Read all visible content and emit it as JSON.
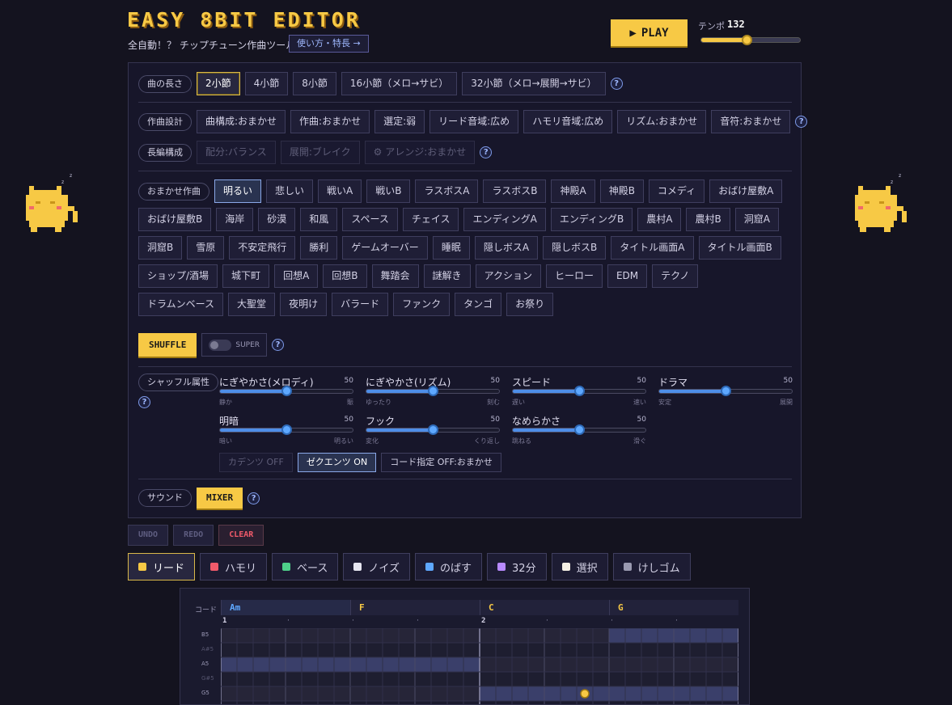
{
  "header": {
    "title": "EASY 8BIT EDITOR",
    "subtitle": "全自動！？ チップチューン作曲ツール",
    "howto_label": "使い方・特長 →",
    "play_label": "PLAY",
    "tempo_label": "テンポ",
    "tempo_value": "132",
    "tempo_fraction": 0.46
  },
  "length": {
    "label": "曲の長さ",
    "options": [
      "2小節",
      "4小節",
      "8小節",
      "16小節（メロ→サビ）",
      "32小節（メロ→展開→サビ）"
    ],
    "selected": "2小節"
  },
  "design": {
    "label": "作曲設計",
    "options": [
      "曲構成:おまかせ",
      "作曲:おまかせ",
      "選定:弱",
      "リード音域:広め",
      "ハモリ音域:広め",
      "リズム:おまかせ",
      "音符:おまかせ"
    ]
  },
  "long_form": {
    "label": "長編構成",
    "options": [
      "配分:バランス",
      "展開:ブレイク",
      "アレンジ:おまかせ"
    ],
    "gear_icon": "⚙"
  },
  "auto": {
    "label": "おまかせ作曲",
    "selected": "明るい",
    "styles": [
      "明るい",
      "悲しい",
      "戦いA",
      "戦いB",
      "ラスボスA",
      "ラスボスB",
      "神殿A",
      "神殿B",
      "コメディ",
      "おばけ屋敷A",
      "おばけ屋敷B",
      "海岸",
      "砂漠",
      "和風",
      "スペース",
      "チェイス",
      "エンディングA",
      "エンディングB",
      "農村A",
      "農村B",
      "洞窟A",
      "洞窟B",
      "雪原",
      "不安定飛行",
      "勝利",
      "ゲームオーバー",
      "睡眠",
      "隠しボスA",
      "隠しボスB",
      "タイトル画面A",
      "タイトル画面B",
      "ショップ/酒場",
      "城下町",
      "回想A",
      "回想B",
      "舞踏会",
      "謎解き",
      "アクション",
      "ヒーロー",
      "EDM",
      "テクノ",
      "ドラムンベース",
      "大聖堂",
      "夜明け",
      "バラード",
      "ファンク",
      "タンゴ",
      "お祭り"
    ]
  },
  "shuffle": {
    "label": "SHUFFLE",
    "super_label": "SUPER"
  },
  "attributes": {
    "label": "シャッフル属性",
    "sliders": [
      {
        "name": "にぎやかさ(メロディ)",
        "value": "50",
        "lo": "静か",
        "hi": "賑"
      },
      {
        "name": "にぎやかさ(リズム)",
        "value": "50",
        "lo": "ゆったり",
        "hi": "刻む"
      },
      {
        "name": "スピード",
        "value": "50",
        "lo": "遅い",
        "hi": "速い"
      },
      {
        "name": "ドラマ",
        "value": "50",
        "lo": "安定",
        "hi": "展開"
      },
      {
        "name": "明暗",
        "value": "50",
        "lo": "暗い",
        "hi": "明るい"
      },
      {
        "name": "フック",
        "value": "50",
        "lo": "変化",
        "hi": "くり返し"
      },
      {
        "name": "なめらかさ",
        "value": "50",
        "lo": "跳ねる",
        "hi": "滑ぐ"
      }
    ],
    "toggles": [
      "カデンツ OFF",
      "ゼクエンツ ON",
      "コード指定 OFF:おまかせ"
    ]
  },
  "sound": {
    "label": "サウンド",
    "mixer_label": "MIXER"
  },
  "history": {
    "undo": "UNDO",
    "redo": "REDO",
    "clear": "CLEAR"
  },
  "tools": [
    {
      "label": "リード",
      "color": "#f7c945"
    },
    {
      "label": "ハモリ",
      "color": "#f05a6a"
    },
    {
      "label": "ベース",
      "color": "#4ed08a"
    },
    {
      "label": "ノイズ",
      "color": "#e6e6f0"
    },
    {
      "label": "のばす",
      "color": "#5ea8ff"
    },
    {
      "label": "32分",
      "color": "#b88aff"
    },
    {
      "label": "選択",
      "color": "#f4efe4"
    },
    {
      "label": "けしゴム",
      "color": "#9a9ab0"
    }
  ],
  "roll": {
    "chord_label": "コード",
    "chords": [
      {
        "name": "Am",
        "color": "#5ea8ff"
      },
      {
        "name": "F",
        "color": "#f7c945"
      },
      {
        "name": "C",
        "color": "#f7c945"
      },
      {
        "name": "G",
        "color": "#f7c945"
      }
    ],
    "bars": [
      "1",
      "2"
    ],
    "notes": [
      "B5",
      "A#5",
      "A5",
      "G#5",
      "G5"
    ]
  }
}
